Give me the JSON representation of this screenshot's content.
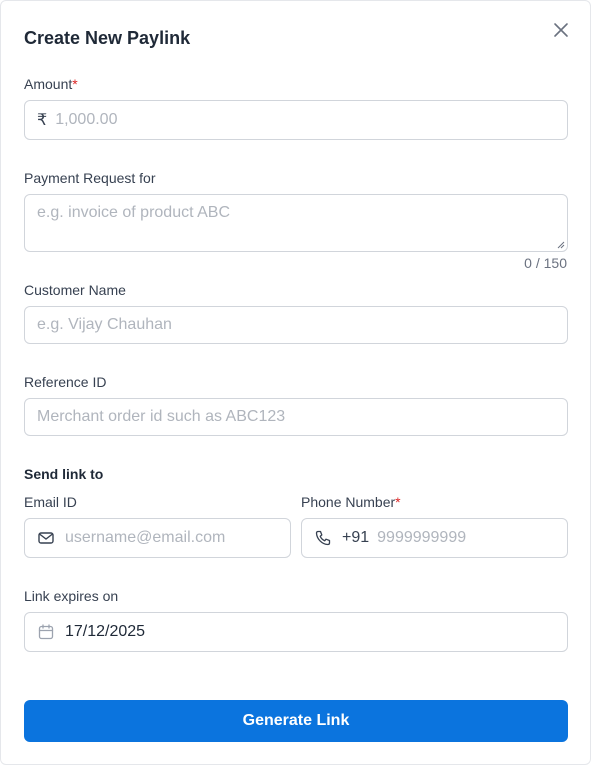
{
  "modal": {
    "title": "Create New Paylink",
    "close_icon": "close-icon"
  },
  "amount": {
    "label": "Amount",
    "required_mark": "*",
    "currency_symbol": "₹",
    "placeholder": "1,000.00",
    "value": ""
  },
  "payment_request": {
    "label": "Payment Request for",
    "placeholder": "e.g. invoice of product ABC",
    "value": "",
    "counter": "0 / 150"
  },
  "customer_name": {
    "label": "Customer Name",
    "placeholder": "e.g. Vijay Chauhan",
    "value": ""
  },
  "reference_id": {
    "label": "Reference ID",
    "placeholder": "Merchant order id such as ABC123",
    "value": ""
  },
  "send_link": {
    "heading": "Send link to",
    "email": {
      "label": "Email ID",
      "placeholder": "username@email.com",
      "value": "",
      "icon": "mail-icon"
    },
    "phone": {
      "label": "Phone Number",
      "required_mark": "*",
      "country_code": "+91",
      "placeholder": "9999999999",
      "value": "",
      "icon": "phone-icon"
    }
  },
  "expiry": {
    "label": "Link expires on",
    "value": "17/12/2025",
    "icon": "calendar-icon"
  },
  "submit": {
    "label": "Generate Link"
  },
  "colors": {
    "primary": "#0b74de",
    "required": "#dc2626",
    "border": "#d1d5db",
    "placeholder": "#b0b5bd"
  }
}
